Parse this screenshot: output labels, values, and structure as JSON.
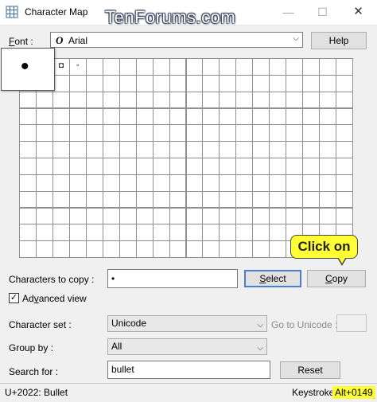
{
  "window": {
    "title": "Character Map",
    "watermark": "TenForums.com",
    "minimize_glyph": "—",
    "maximize_glyph": "☐",
    "close_glyph": "✕"
  },
  "font": {
    "label_prefix": "",
    "label_key": "F",
    "label_rest": "ont :",
    "glyph": "O",
    "value": "Arial",
    "help_label": "Help"
  },
  "grid": {
    "rows": 12,
    "cols": 20,
    "cells": [
      "",
      "•",
      "◘",
      "◦"
    ],
    "enlarged_char": "•"
  },
  "callout": {
    "text": "Click on"
  },
  "copy_row": {
    "label": "Characters to copy :",
    "value": "•",
    "select_label": "Select",
    "select_key": "S",
    "copy_label": "Copy",
    "copy_key": "C"
  },
  "advanced": {
    "label": "Advanced view",
    "key": "v",
    "checked": "✓"
  },
  "character_set": {
    "label": "Character set :",
    "value": "Unicode",
    "goto_label": "Go to Unicode :"
  },
  "group_by": {
    "label": "Group by :",
    "value": "All"
  },
  "search": {
    "label": "Search for :",
    "value": "bullet",
    "reset_label": "Reset"
  },
  "status": {
    "info": "U+2022: Bullet",
    "keystroke_label": "Keystroke:",
    "keystroke_value": "Alt+0149"
  }
}
